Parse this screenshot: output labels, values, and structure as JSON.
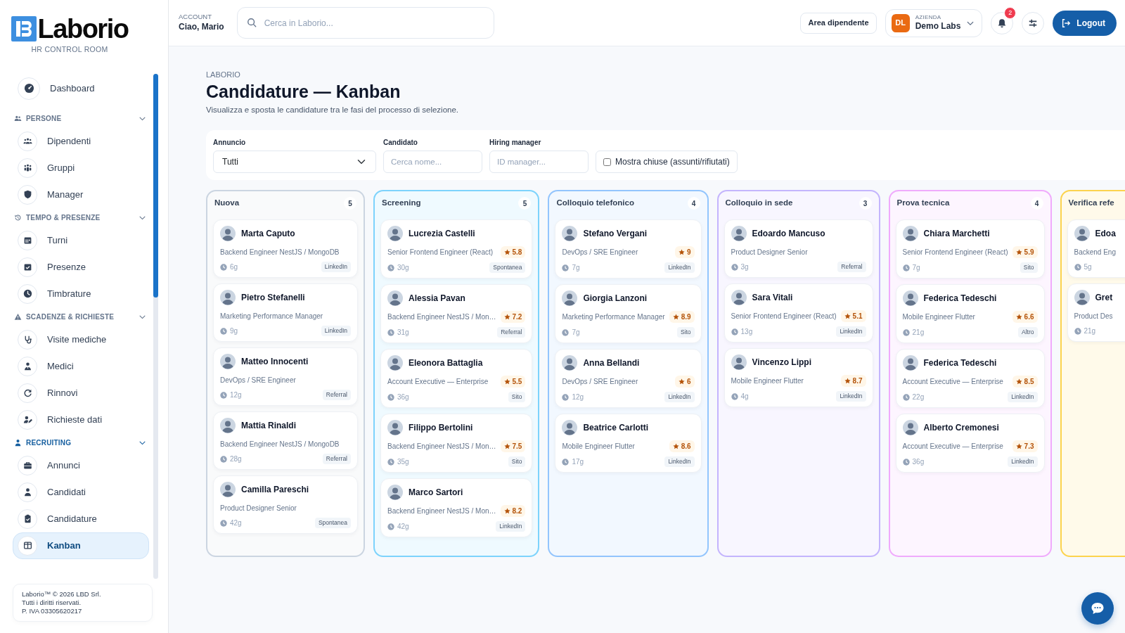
{
  "brand": {
    "name": "Laborio",
    "tagline": "HR CONTROL ROOM"
  },
  "sidebar": {
    "items": [
      {
        "kind": "link",
        "label": "Dashboard",
        "selected": false
      },
      {
        "kind": "section",
        "label": "PERSONE",
        "expanded": true,
        "children": [
          {
            "label": "Dipendenti",
            "selected": false
          },
          {
            "label": "Gruppi",
            "selected": false
          },
          {
            "label": "Manager",
            "selected": false
          }
        ]
      },
      {
        "kind": "section",
        "label": "TEMPO & PRESENZE",
        "expanded": true,
        "children": [
          {
            "label": "Turni",
            "selected": false
          },
          {
            "label": "Presenze",
            "selected": false
          },
          {
            "label": "Timbrature",
            "selected": false
          }
        ]
      },
      {
        "kind": "section",
        "label": "SCADENZE & RICHIESTE",
        "expanded": true,
        "children": [
          {
            "label": "Visite mediche",
            "selected": false
          },
          {
            "label": "Medici",
            "selected": false
          },
          {
            "label": "Rinnovi",
            "selected": false
          },
          {
            "label": "Richieste dati",
            "selected": false
          }
        ]
      },
      {
        "kind": "section",
        "label": "RECRUITING",
        "expanded": true,
        "children": [
          {
            "label": "Annunci",
            "selected": false
          },
          {
            "label": "Candidati",
            "selected": false
          },
          {
            "label": "Candidature",
            "selected": false
          },
          {
            "label": "Kanban",
            "selected": true
          }
        ]
      }
    ],
    "footer": [
      "Laborio™ © 2026 LBD Srl.",
      "Tutti i diritti riservati.",
      "P. IVA 03305620217"
    ]
  },
  "topbar": {
    "account_label": "ACCOUNT",
    "account_name": "Ciao, Mario",
    "search": {
      "placeholder": "Cerca in Laborio..."
    },
    "employee_area_button": "Area dipendente",
    "company": {
      "initials": "DL",
      "label": "AZIENDA",
      "name": "Demo Labs"
    },
    "notifications_count": "2",
    "logout_button": "Logout"
  },
  "page": {
    "eyebrow": "LABORIO",
    "title": "Candidature — Kanban",
    "subtitle": "Visualizza e sposta le candidature tra le fasi del processo di selezione."
  },
  "filters": [
    {
      "kind": "select",
      "label": "Annuncio",
      "value": "Tutti"
    },
    {
      "kind": "text",
      "label": "Candidato",
      "placeholder": "Cerca nome..."
    },
    {
      "kind": "text",
      "label": "Hiring manager",
      "placeholder": "ID manager..."
    },
    {
      "kind": "checkbox",
      "label": "Mostra chiuse (assunti/rifiutati)",
      "checked": false
    }
  ],
  "columns": [
    {
      "title": "Nuova",
      "count": "5",
      "color": "#cbd5e1",
      "cards": [
        {
          "name": "Marta Caputo",
          "role": "Backend Engineer NestJS / MongoDB",
          "age": "6g",
          "source": "LinkedIn"
        },
        {
          "name": "Pietro Stefanelli",
          "role": "Marketing Performance Manager",
          "age": "9g",
          "source": "LinkedIn"
        },
        {
          "name": "Matteo Innocenti",
          "role": "DevOps / SRE Engineer",
          "age": "12g",
          "source": "Referral"
        },
        {
          "name": "Mattia Rinaldi",
          "role": "Backend Engineer NestJS / MongoDB",
          "age": "28g",
          "source": "Referral"
        },
        {
          "name": "Camilla Pareschi",
          "role": "Product Designer Senior",
          "age": "42g",
          "source": "Spontanea"
        }
      ]
    },
    {
      "title": "Screening",
      "count": "5",
      "color": "#7dd3fc",
      "cards": [
        {
          "name": "Lucrezia Castelli",
          "role": "Senior Frontend Engineer (React)",
          "score": "5.8",
          "age": "30g",
          "source": "Spontanea"
        },
        {
          "name": "Alessia Pavan",
          "role": "Backend Engineer NestJS / Mon…",
          "score": "7.2",
          "age": "31g",
          "source": "Referral"
        },
        {
          "name": "Eleonora Battaglia",
          "role": "Account Executive — Enterprise",
          "score": "5.5",
          "age": "36g",
          "source": "Sito"
        },
        {
          "name": "Filippo Bertolini",
          "role": "Backend Engineer NestJS / Mon…",
          "score": "7.5",
          "age": "35g",
          "source": "Sito"
        },
        {
          "name": "Marco Sartori",
          "role": "Backend Engineer NestJS / Mon…",
          "score": "8.2",
          "age": "42g",
          "source": "LinkedIn"
        }
      ]
    },
    {
      "title": "Colloquio telefonico",
      "count": "4",
      "color": "#93c5fd",
      "cards": [
        {
          "name": "Stefano Vergani",
          "role": "DevOps / SRE Engineer",
          "score": "9",
          "age": "7g",
          "source": "LinkedIn"
        },
        {
          "name": "Giorgia Lanzoni",
          "role": "Marketing Performance Manager",
          "score": "8.9",
          "age": "7g",
          "source": "Sito"
        },
        {
          "name": "Anna Bellandi",
          "role": "DevOps / SRE Engineer",
          "score": "6",
          "age": "12g",
          "source": "LinkedIn"
        },
        {
          "name": "Beatrice Carlotti",
          "role": "Mobile Engineer Flutter",
          "score": "8.6",
          "age": "17g",
          "source": "LinkedIn"
        }
      ]
    },
    {
      "title": "Colloquio in sede",
      "count": "3",
      "color": "#c4b5fd",
      "cards": [
        {
          "name": "Edoardo Mancuso",
          "role": "Product Designer Senior",
          "age": "3g",
          "source": "Referral"
        },
        {
          "name": "Sara Vitali",
          "role": "Senior Frontend Engineer (React)",
          "score": "5.1",
          "age": "13g",
          "source": "LinkedIn"
        },
        {
          "name": "Vincenzo Lippi",
          "role": "Mobile Engineer Flutter",
          "score": "8.7",
          "age": "4g",
          "source": "LinkedIn"
        }
      ]
    },
    {
      "title": "Prova tecnica",
      "count": "4",
      "color": "#f0abfc",
      "cards": [
        {
          "name": "Chiara Marchetti",
          "role": "Senior Frontend Engineer (React)",
          "score": "5.9",
          "age": "7g",
          "source": "Sito"
        },
        {
          "name": "Federica Tedeschi",
          "role": "Mobile Engineer Flutter",
          "score": "6.6",
          "age": "21g",
          "source": "Altro"
        },
        {
          "name": "Federica Tedeschi",
          "role": "Account Executive — Enterprise",
          "score": "8.5",
          "age": "22g",
          "source": "LinkedIn"
        },
        {
          "name": "Alberto Cremonesi",
          "role": "Account Executive — Enterprise",
          "score": "7.3",
          "age": "36g",
          "source": "LinkedIn"
        }
      ]
    },
    {
      "title": "Verifica refe",
      "color": "#fcd34d",
      "cards": [
        {
          "name": "Edoa",
          "role": "Backend Eng",
          "age": "5g"
        },
        {
          "name": "Gret",
          "role": "Product Des",
          "age": "21g"
        }
      ]
    }
  ]
}
